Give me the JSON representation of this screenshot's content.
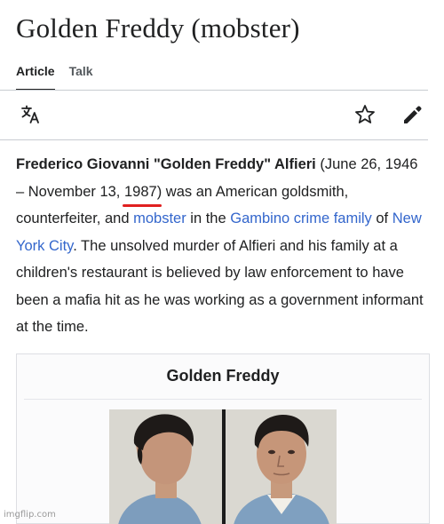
{
  "header": {
    "title": "Golden Freddy (mobster)"
  },
  "tabs": [
    {
      "label": "Article",
      "active": true
    },
    {
      "label": "Talk",
      "active": false
    }
  ],
  "toolbar": {
    "icons": [
      "translate-icon",
      "star-icon",
      "edit-icon"
    ]
  },
  "article": {
    "name_bold": "Frederico Giovanni \"Golden Freddy\" Alfieri",
    "open_paren": " (June 26, 1946 – November 13, ",
    "death_year": "1987)",
    "text_1": " was an American goldsmith, counterfeiter, and ",
    "link_mobster": "mobster",
    "text_2": " in the ",
    "link_gambino": "Gambino crime family",
    "text_3": " of ",
    "link_nyc": "New York City",
    "text_4": ". The unsolved murder of Alfieri and his family at a children's restaurant is believed by law enforcement to have been a mafia hit as he was working as a government informant at the time."
  },
  "infobox": {
    "title": "Golden Freddy"
  },
  "watermark": "imgflip.com",
  "colors": {
    "link": "#3366cc",
    "text": "#202122",
    "underline_mark": "#e02020"
  }
}
